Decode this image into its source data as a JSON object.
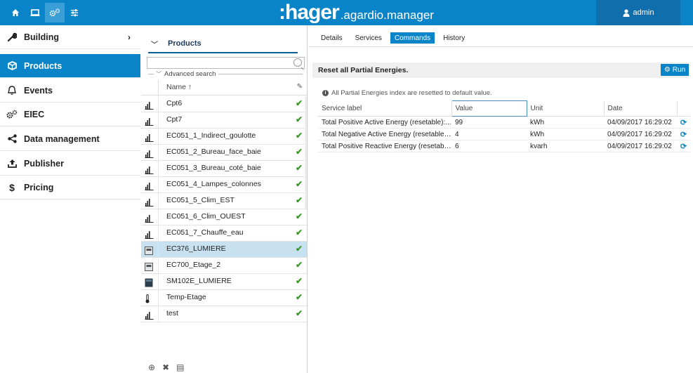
{
  "topbar": {
    "logo_brand": ":hager",
    "logo_product": ".agardio.manager",
    "user": "admin",
    "nav_icons": [
      "home-icon",
      "monitor-icon",
      "gears-icon",
      "sliders-icon"
    ]
  },
  "sidebar": {
    "items": [
      {
        "label": "Building",
        "icon": "wrench-icon",
        "active": false,
        "has_chevron": true
      },
      {
        "label": "Products",
        "icon": "box-icon",
        "active": true,
        "has_chevron": false
      },
      {
        "label": "Events",
        "icon": "bell-icon",
        "active": false,
        "has_chevron": false
      },
      {
        "label": "EIEC",
        "icon": "gears-icon",
        "active": false,
        "has_chevron": false
      },
      {
        "label": "Data management",
        "icon": "share-icon",
        "active": false,
        "has_chevron": false
      },
      {
        "label": "Publisher",
        "icon": "upload-icon",
        "active": false,
        "has_chevron": false
      },
      {
        "label": "Pricing",
        "icon": "dollar-icon",
        "active": false,
        "has_chevron": false
      }
    ]
  },
  "products": {
    "title": "Products",
    "search_placeholder": "",
    "advanced_search": "Advanced search",
    "column_name": "Name ↑",
    "rows": [
      {
        "name": "Cpt6",
        "device": "meter",
        "selected": false
      },
      {
        "name": "Cpt7",
        "device": "meter",
        "selected": false
      },
      {
        "name": "EC051_1_Indirect_goulotte",
        "device": "meter",
        "selected": false
      },
      {
        "name": "EC051_2_Bureau_face_baie",
        "device": "meter",
        "selected": false
      },
      {
        "name": "EC051_3_Bureau_coté_baie",
        "device": "meter",
        "selected": false
      },
      {
        "name": "EC051_4_Lampes_colonnes",
        "device": "meter",
        "selected": false
      },
      {
        "name": "EC051_5_Clim_EST",
        "device": "meter",
        "selected": false
      },
      {
        "name": "EC051_6_Clim_OUEST",
        "device": "meter",
        "selected": false
      },
      {
        "name": "EC051_7_Chauffe_eau",
        "device": "meter",
        "selected": false
      },
      {
        "name": "EC376_LUMIERE",
        "device": "counter",
        "selected": true
      },
      {
        "name": "EC700_Etage_2",
        "device": "counter",
        "selected": false
      },
      {
        "name": "SM102E_LUMIERE",
        "device": "module",
        "selected": false
      },
      {
        "name": "Temp-Etage",
        "device": "thermometer",
        "selected": false
      },
      {
        "name": "test",
        "device": "meter",
        "selected": false
      }
    ]
  },
  "content": {
    "tabs": [
      {
        "label": "Details",
        "active": false
      },
      {
        "label": "Services",
        "active": false
      },
      {
        "label": "Commands",
        "active": true
      },
      {
        "label": "History",
        "active": false
      }
    ],
    "action_title": "Reset all Partial Energies.",
    "run_label": "Run",
    "info_text": "All Partial Energies index are resetted to default value.",
    "table": {
      "headers": [
        "Service label",
        "Value",
        "Unit",
        "Date"
      ],
      "rows": [
        {
          "label": "Total Positive Active Energy (resetable):...",
          "value": "99",
          "unit": "kWh",
          "date": "04/09/2017 16:29:02"
        },
        {
          "label": "Total Negative Active Energy (resetable)...",
          "value": "4",
          "unit": "kWh",
          "date": "04/09/2017 16:29:02"
        },
        {
          "label": "Total Positive Reactive Energy (resetabl...",
          "value": "6",
          "unit": "kvarh",
          "date": "04/09/2017 16:29:02"
        }
      ]
    }
  },
  "colors": {
    "primary": "#0a84c8",
    "ok_green": "#3a9a28",
    "selected_row": "#c7e1f1"
  }
}
